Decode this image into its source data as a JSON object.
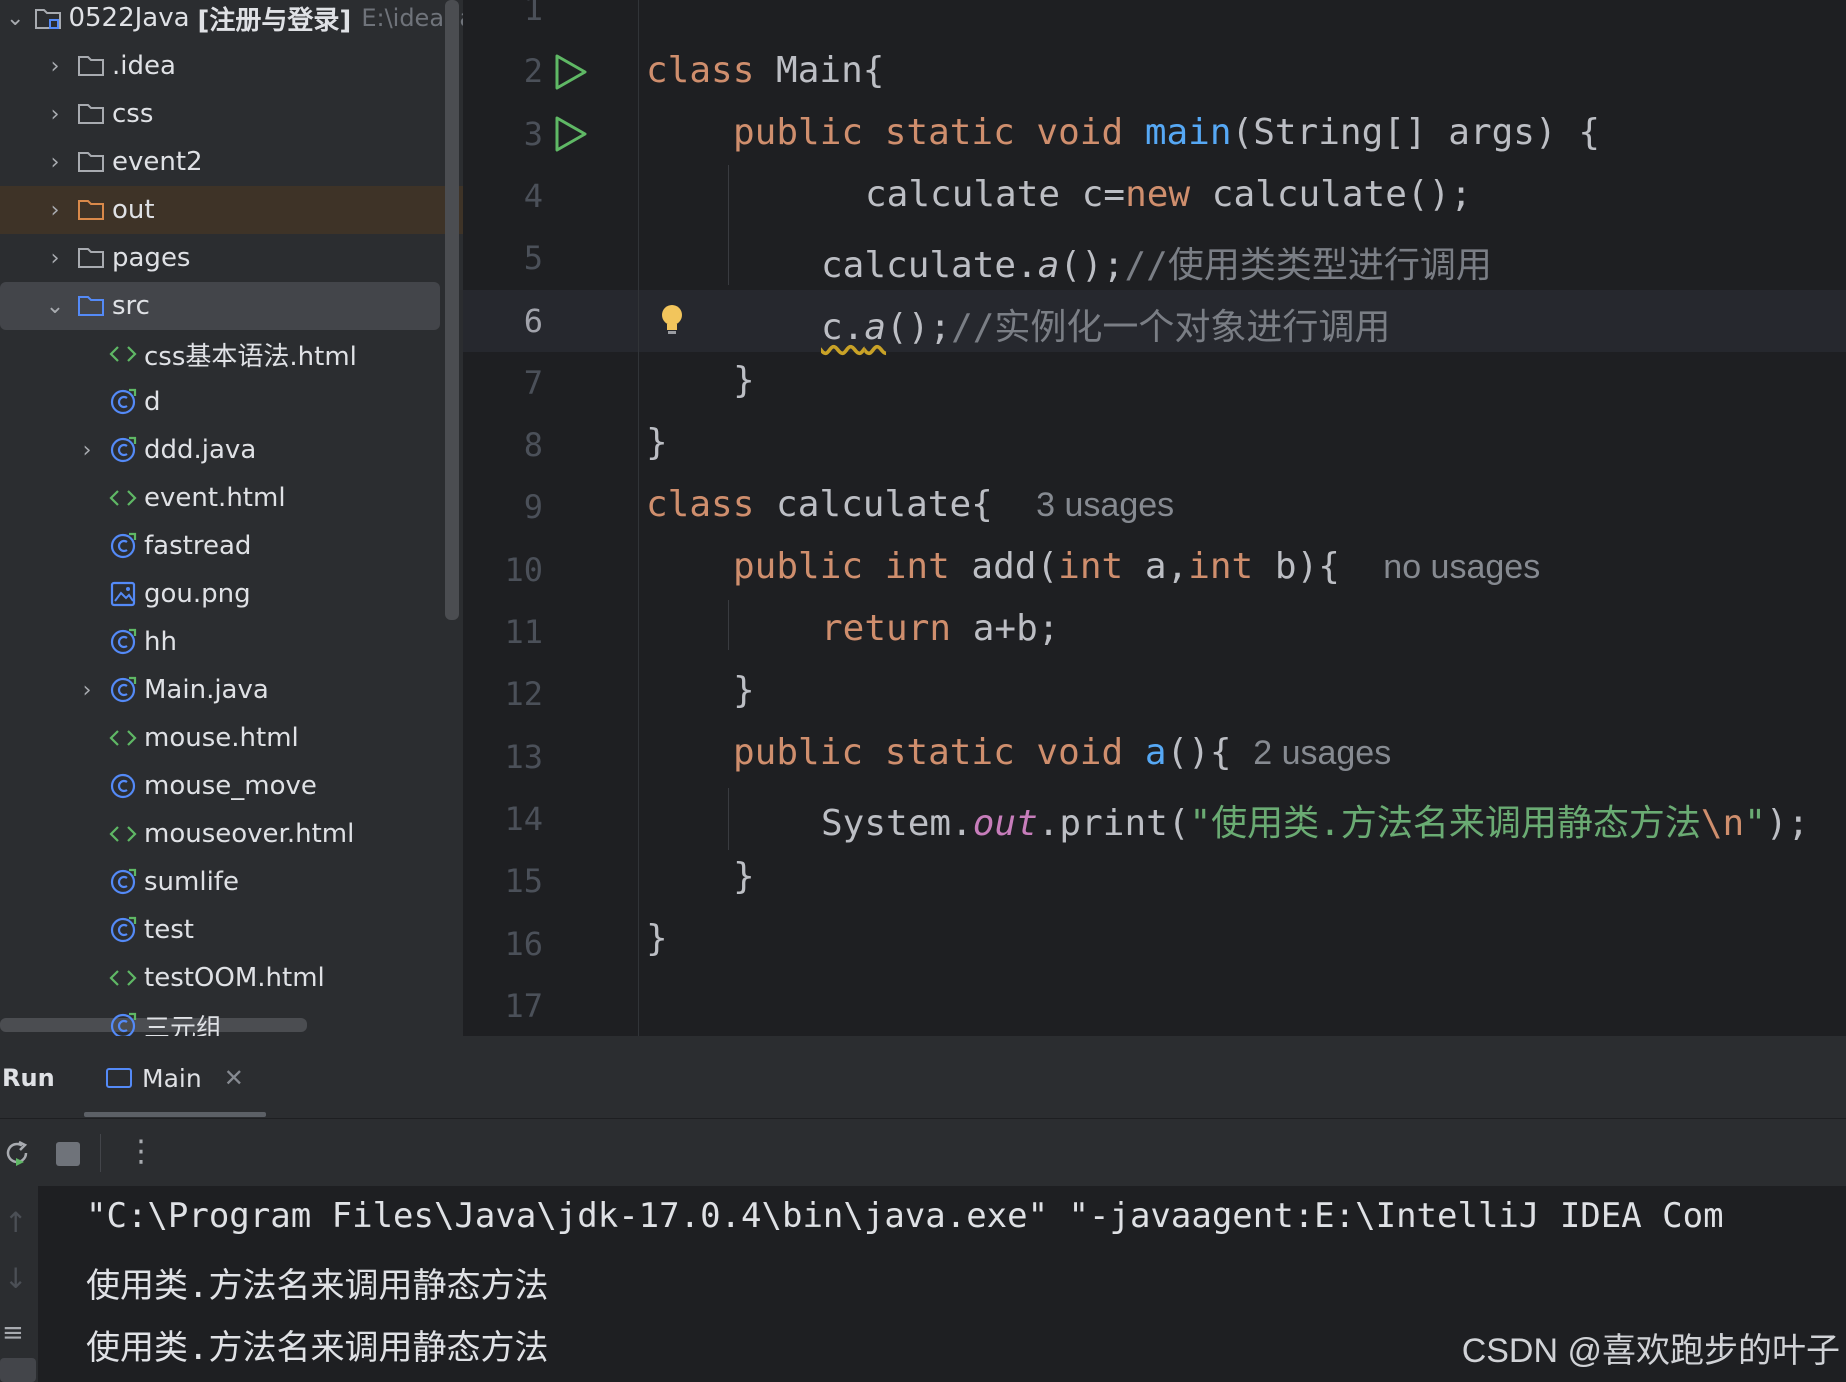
{
  "project": {
    "root": {
      "name": "0522Java",
      "tag": "[注册与登录]",
      "path": "E:\\idea-jav"
    },
    "items": [
      {
        "label": ".idea",
        "icon": "folder-icon"
      },
      {
        "label": "css",
        "icon": "folder-icon"
      },
      {
        "label": "event2",
        "icon": "folder-icon"
      },
      {
        "label": "out",
        "icon": "folder-orange-icon"
      },
      {
        "label": "pages",
        "icon": "folder-icon"
      },
      {
        "label": "src",
        "icon": "folder-blue-icon"
      },
      {
        "label": "css基本语法.html",
        "icon": "html-icon"
      },
      {
        "label": "d",
        "icon": "java-class-icon"
      },
      {
        "label": "ddd.java",
        "icon": "java-class-icon"
      },
      {
        "label": "event.html",
        "icon": "html-icon"
      },
      {
        "label": "fastread",
        "icon": "java-class-icon"
      },
      {
        "label": "gou.png",
        "icon": "image-icon"
      },
      {
        "label": "hh",
        "icon": "java-class-icon"
      },
      {
        "label": "Main.java",
        "icon": "java-class-icon"
      },
      {
        "label": "mouse.html",
        "icon": "html-icon"
      },
      {
        "label": "mouse_move",
        "icon": "class-icon"
      },
      {
        "label": "mouseover.html",
        "icon": "html-icon"
      },
      {
        "label": "sumlife",
        "icon": "java-class-icon"
      },
      {
        "label": "test",
        "icon": "java-class-icon"
      },
      {
        "label": "testOOM.html",
        "icon": "html-icon"
      },
      {
        "label": "三元组",
        "icon": "java-class-icon"
      }
    ]
  },
  "editor": {
    "line_numbers": [
      "1",
      "2",
      "3",
      "4",
      "5",
      "6",
      "7",
      "8",
      "9",
      "10",
      "11",
      "12",
      "13",
      "14",
      "15",
      "16",
      "17"
    ],
    "active_line": "6",
    "code": {
      "l2_kw": "class",
      "l2_rest": " Main{",
      "l3_kw": "public static void",
      "l3_fn": "main",
      "l3_rest": "(String[] args) {",
      "l4_a": "calculate c=",
      "l4_kw": "new",
      "l4_b": " calculate();",
      "l5_a": "calculate.",
      "l5_it": "a",
      "l5_b": "();",
      "l5_cm": "//使用类类型进行调用",
      "l6_a": "c.",
      "l6_it": "a",
      "l6_b": "();",
      "l6_cm": "//实例化一个对象进行调用",
      "l7": "}",
      "l8": "}",
      "l9_kw": "class",
      "l9_rest": " calculate{",
      "l9_hint": "3 usages",
      "l10_kw1": "public int",
      "l10_fn": " add",
      "l10_p": "(",
      "l10_kw2": "int",
      "l10_a": " a,",
      "l10_kw3": "int",
      "l10_b": " b){",
      "l10_hint": "no usages",
      "l11_kw": "return",
      "l11_rest": " a+b;",
      "l12": "}",
      "l13_kw": "public static void",
      "l13_fn": " a",
      "l13_rest": "(){",
      "l13_hint": "2 usages",
      "l14_a": "System.",
      "l14_pf": "out",
      "l14_b": ".print(",
      "l14_st": "\"使用类.方法名来调用静态方法",
      "l14_esc": "\\n",
      "l14_st2": "\"",
      "l14_end": ");",
      "l15": "}",
      "l16": "}"
    }
  },
  "run": {
    "title": "Run",
    "tab_label": "Main",
    "console_lines": [
      "\"C:\\Program Files\\Java\\jdk-17.0.4\\bin\\java.exe\" \"-javaagent:E:\\IntelliJ IDEA Com",
      "使用类.方法名来调用静态方法",
      "使用类.方法名来调用静态方法"
    ]
  },
  "watermark": "CSDN @喜欢跑步的叶子",
  "colors": {
    "keyword": "#cf8e6d",
    "function": "#56a8f5",
    "string": "#6aab73",
    "comment": "#7a7e85",
    "static_field": "#c77dbb",
    "run_gutter": "#5fb865"
  }
}
